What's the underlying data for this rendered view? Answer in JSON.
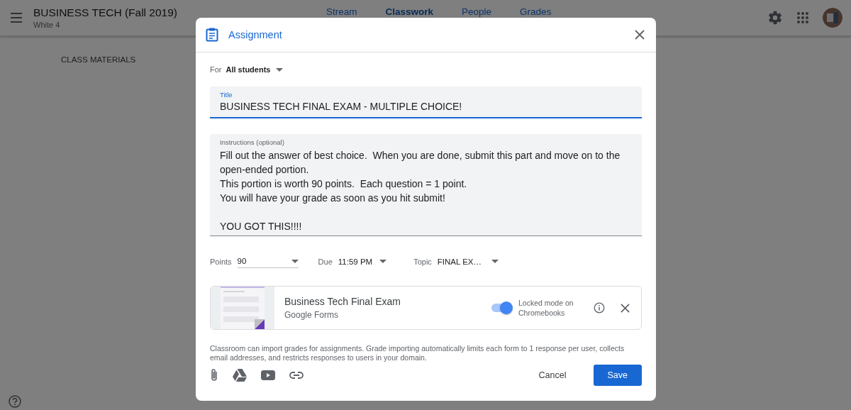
{
  "app_bar": {
    "course_title": "BUSINESS TECH (Fall 2019)",
    "section": "White 4",
    "tabs": [
      {
        "label": "Stream",
        "selected": false
      },
      {
        "label": "Classwork",
        "selected": true
      },
      {
        "label": "People",
        "selected": false
      },
      {
        "label": "Grades",
        "selected": false
      }
    ]
  },
  "page": {
    "heading": "CLASS MATERIALS"
  },
  "dialog": {
    "title": "Assignment",
    "for_label": "For",
    "for_value": "All students",
    "title_field": {
      "label": "Title",
      "value": "BUSINESS TECH FINAL EXAM - MULTIPLE CHOICE!"
    },
    "instructions": {
      "label": "Instructions (optional)",
      "value": "Fill out the answer of best choice.  When you are done, submit this part and move on to the open-ended portion.\nThis portion is worth 90 points.  Each question = 1 point.\nYou will have your grade as soon as you hit submit!\n\nYOU GOT THIS!!!!"
    },
    "points": {
      "label": "Points",
      "value": "90"
    },
    "due": {
      "label": "Due",
      "value": "11:59 PM"
    },
    "topic": {
      "label": "Topic",
      "value": "FINAL EX…"
    },
    "attachment": {
      "name": "Business Tech Final Exam",
      "source": "Google Forms",
      "locked_mode": {
        "label": "Locked mode on Chromebooks",
        "on": true
      }
    },
    "note": "Classroom can import grades for assignments. Grade importing automatically limits each form to 1 response per user, collects email addresses, and restricts responses to users in your domain.",
    "buttons": [
      {
        "label": "Cancel",
        "kind": "text"
      },
      {
        "label": "Save",
        "kind": "primary"
      }
    ]
  }
}
